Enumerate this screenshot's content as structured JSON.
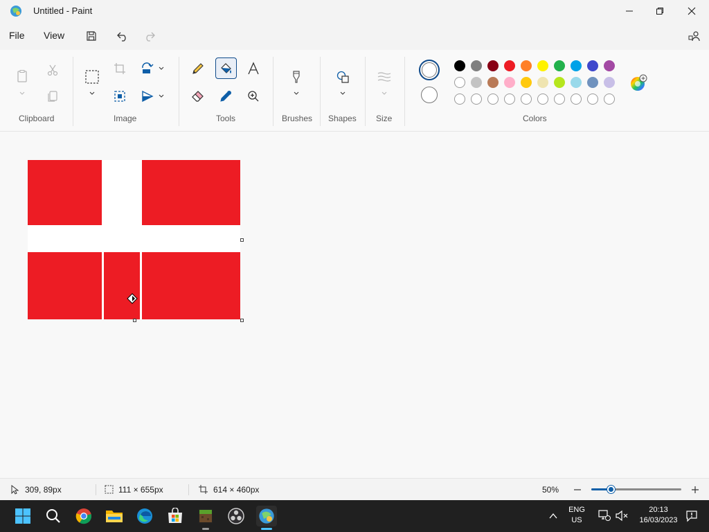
{
  "window": {
    "title": "Untitled - Paint"
  },
  "menu": {
    "file": "File",
    "view": "View"
  },
  "ribbon": {
    "groups": {
      "clipboard": "Clipboard",
      "image": "Image",
      "tools": "Tools",
      "brushes": "Brushes",
      "shapes": "Shapes",
      "size": "Size",
      "colors": "Colors"
    },
    "palette_row1": [
      "#000000",
      "#7f7f7f",
      "#880015",
      "#ed1c24",
      "#ff7f27",
      "#fff200",
      "#22b14c",
      "#00a2e8",
      "#3f48cc",
      "#a349a4"
    ],
    "palette_row2": [
      "#ffffff",
      "#c3c3c3",
      "#b97a57",
      "#ffaec9",
      "#ffc90e",
      "#efe4b0",
      "#b5e61d",
      "#99d9ea",
      "#7092be",
      "#c8bfe7"
    ],
    "palette_row3_empty_count": 10
  },
  "canvas": {
    "fill_color": "#ed1c24",
    "background": "#ffffff"
  },
  "status": {
    "cursor_pos": "309, 89px",
    "selection_size": "111 × 655px",
    "canvas_size": "614 × 460px",
    "zoom": "50%",
    "zoom_level_fraction": 0.22
  },
  "taskbar": {
    "lang_line1": "ENG",
    "lang_line2": "US",
    "time": "20:13",
    "date": "16/03/2023"
  }
}
